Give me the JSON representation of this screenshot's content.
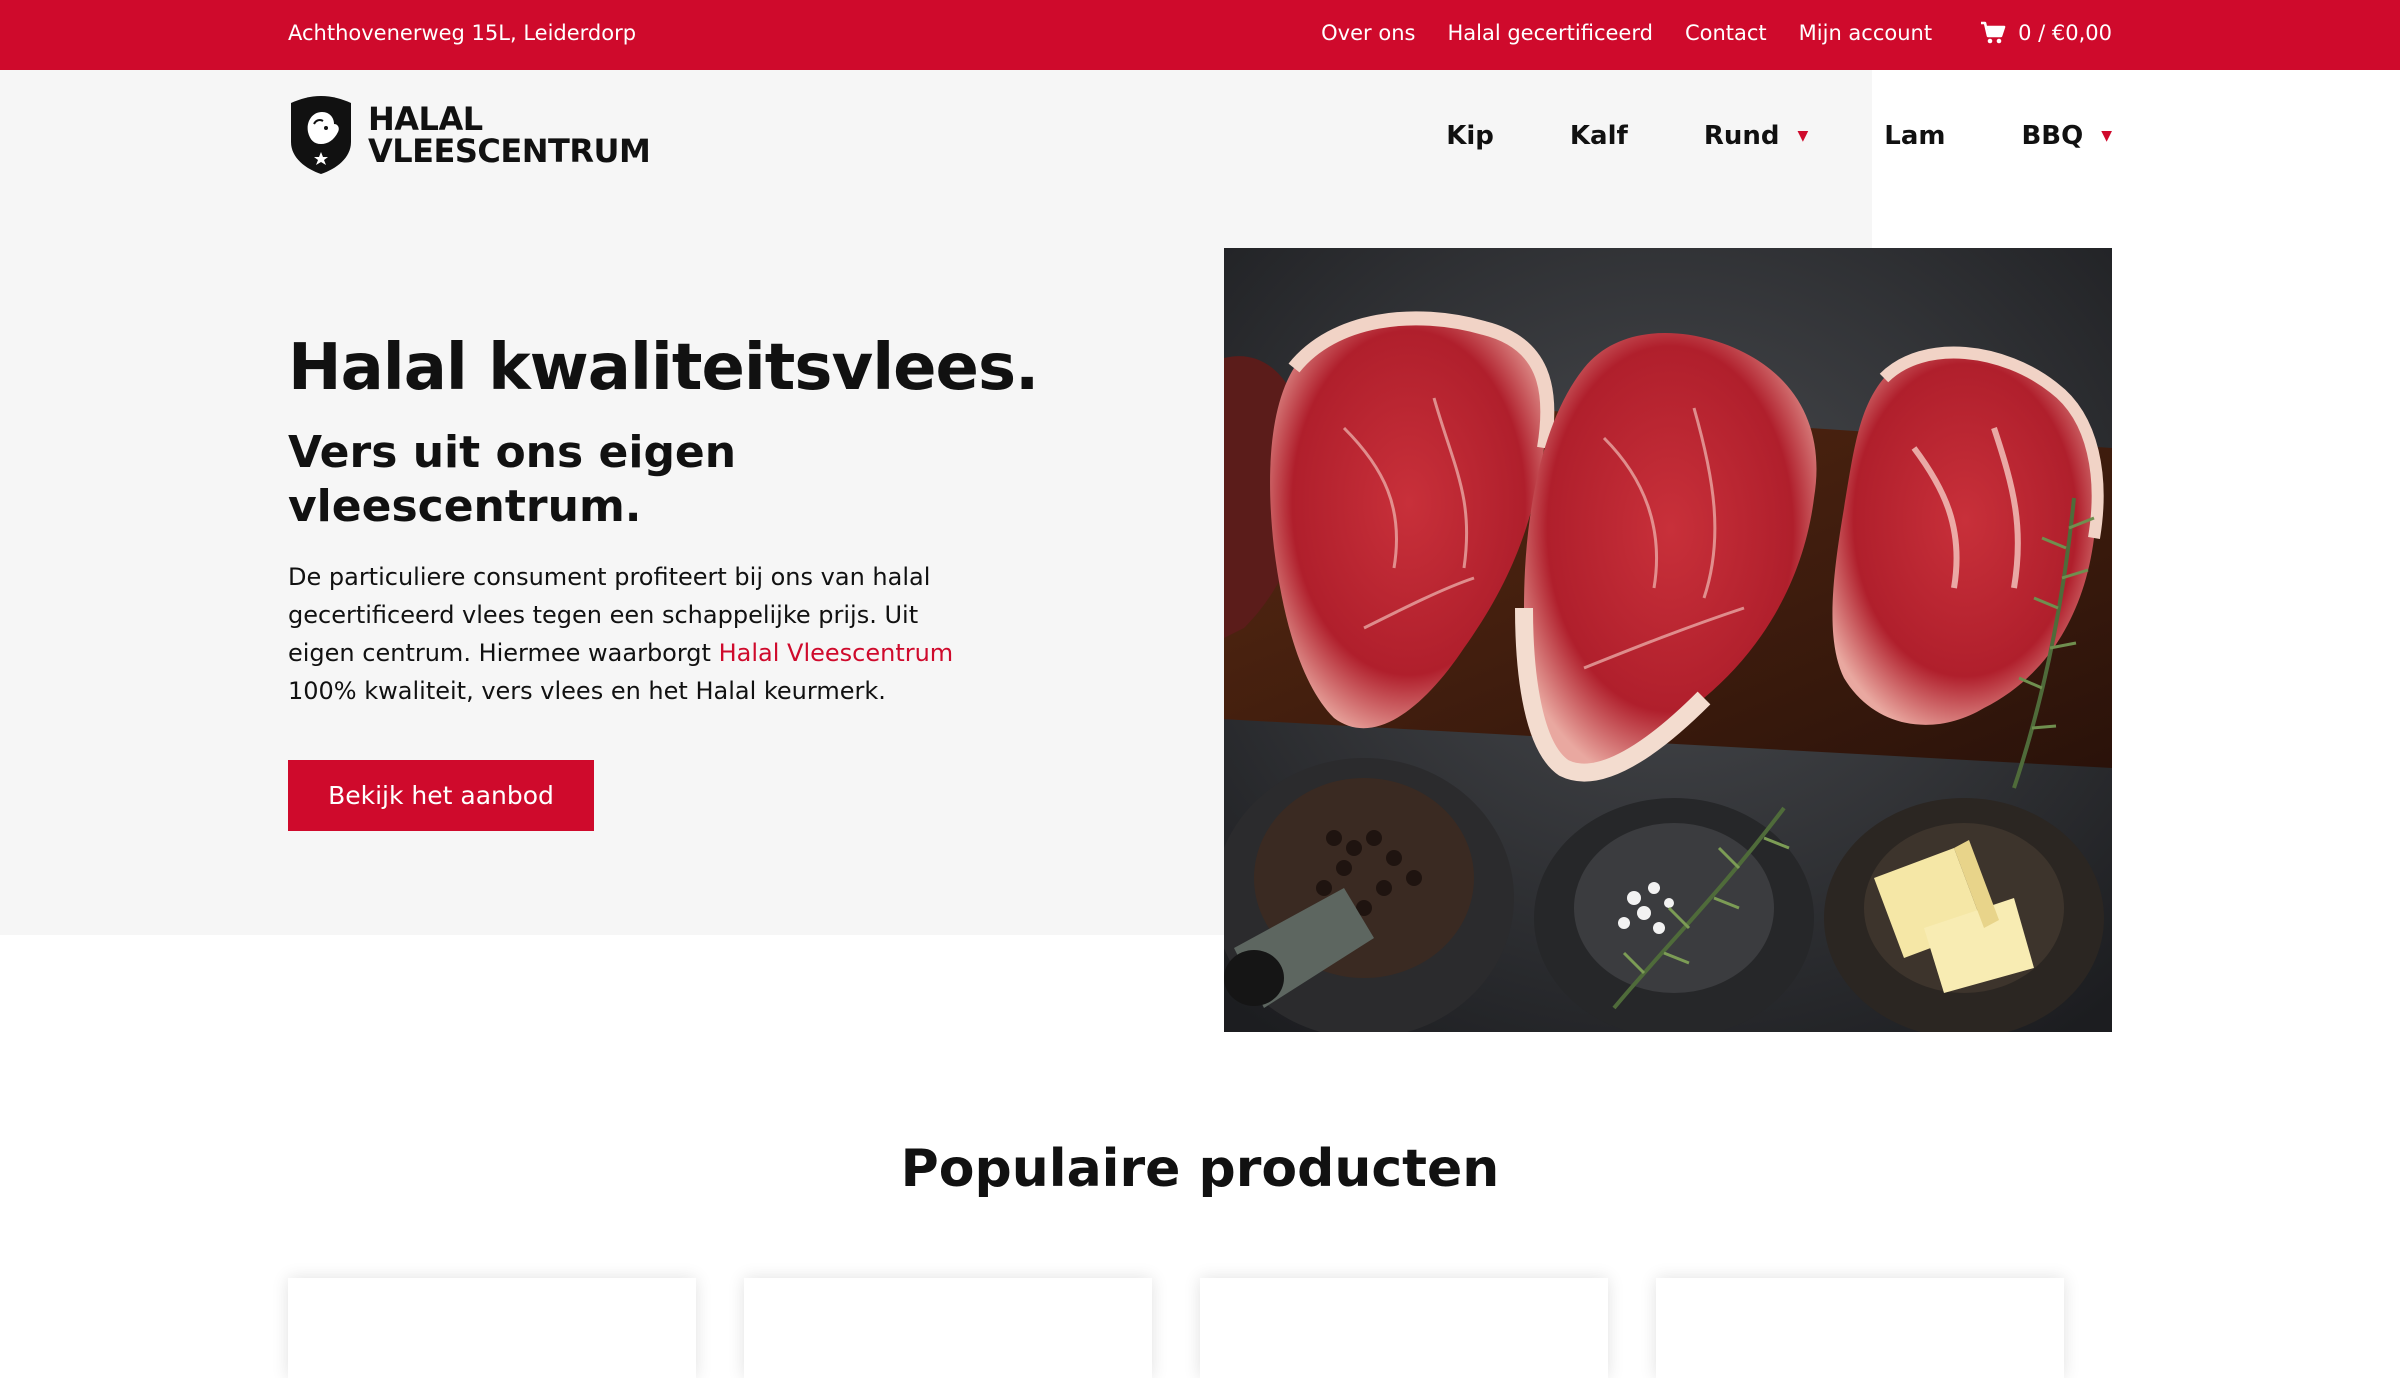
{
  "topbar": {
    "address": "Achthovenerweg 15L, Leiderdorp",
    "links": [
      "Over ons",
      "Halal gecertificeerd",
      "Contact",
      "Mijn account"
    ],
    "cart": "0 / €0,00"
  },
  "logo": {
    "line1": "HALAL",
    "line2": "VLEESCENTRUM"
  },
  "nav": {
    "kip": "Kip",
    "kalf": "Kalf",
    "rund": "Rund",
    "lam": "Lam",
    "bbq": "BBQ"
  },
  "hero": {
    "title": "Halal kwaliteitsvlees.",
    "subtitle": "Vers uit ons eigen vleescentrum.",
    "body_before": "De particuliere consument profiteert bij ons van halal gecertificeerd vlees tegen een schappelijke prijs. Uit eigen centrum. Hiermee waarborgt ",
    "body_link": "Halal Vleescentrum",
    "body_after": " 100% kwaliteit, vers vlees en het Halal keurmerk.",
    "cta": "Bekijk het aanbod"
  },
  "popular": {
    "title": "Populaire producten"
  },
  "colors": {
    "brand_red": "#cf0a2c",
    "hero_bg": "#f6f6f6"
  },
  "icons": {
    "cart": "cart-icon",
    "chevron": "chevron-down-icon",
    "logo": "shield-logo-icon"
  }
}
